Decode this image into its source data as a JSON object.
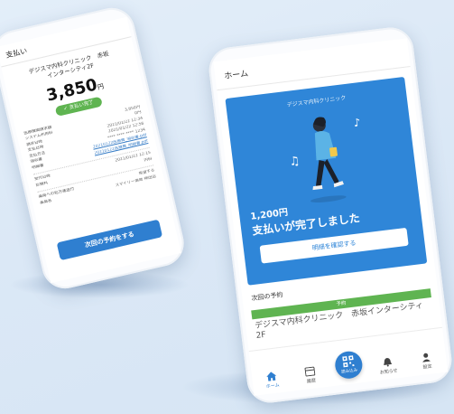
{
  "colors": {
    "primary": "#2f7fd0",
    "success": "#5fb451",
    "background": "#dbe8f6"
  },
  "left_phone": {
    "header": "支払い",
    "clinic_line1": "デジスマ内科クリニック　赤坂",
    "clinic_line2": "インターシティ2F",
    "amount": "3,850",
    "currency": "円",
    "status_badge": "支払い完了",
    "rows": [
      {
        "label": "医療機関請求額",
        "value": "3,850円"
      },
      {
        "label": "システム利用料",
        "value": "0円"
      },
      {
        "label": "請求日時",
        "value": "2021/01/22 12:34"
      },
      {
        "label": "支払日時",
        "value": "2021/01/22 12:56"
      },
      {
        "label": "支払方法",
        "value": "**** **** **** 1234"
      },
      {
        "label": "領収書",
        "value": "20210122医療費_領収書.pdf"
      },
      {
        "label": "明細書",
        "value": "20210122医療費_明細書.pdf"
      }
    ],
    "rows2": [
      {
        "label": "受付日時",
        "value": "2021/01/22 12:15"
      },
      {
        "label": "診療科",
        "value": "内科"
      }
    ],
    "rows3": [
      {
        "label": "薬局への処方箋送付",
        "value": "希望する"
      },
      {
        "label": "薬局名",
        "value": "スマイリー薬局 神田店"
      }
    ],
    "next_button": "次回の予約をする"
  },
  "right_phone": {
    "header": "ホーム",
    "card": {
      "clinic": "デジスマ内科クリニック",
      "price": "1,200円",
      "message": "支払いが完了しました",
      "detail_button": "明細を確認する"
    },
    "next_section": "次回の予約",
    "reservation_label": "予約",
    "reservation_clinic": "デジスマ内科クリニック　赤坂インターシティ2F",
    "tabs": [
      {
        "label": "ホーム",
        "icon": "home-icon"
      },
      {
        "label": "履歴",
        "icon": "history-icon"
      },
      {
        "label": "読み込み",
        "icon": "qr-scan-icon"
      },
      {
        "label": "お知らせ",
        "icon": "bell-icon"
      },
      {
        "label": "設定",
        "icon": "user-icon"
      }
    ]
  }
}
